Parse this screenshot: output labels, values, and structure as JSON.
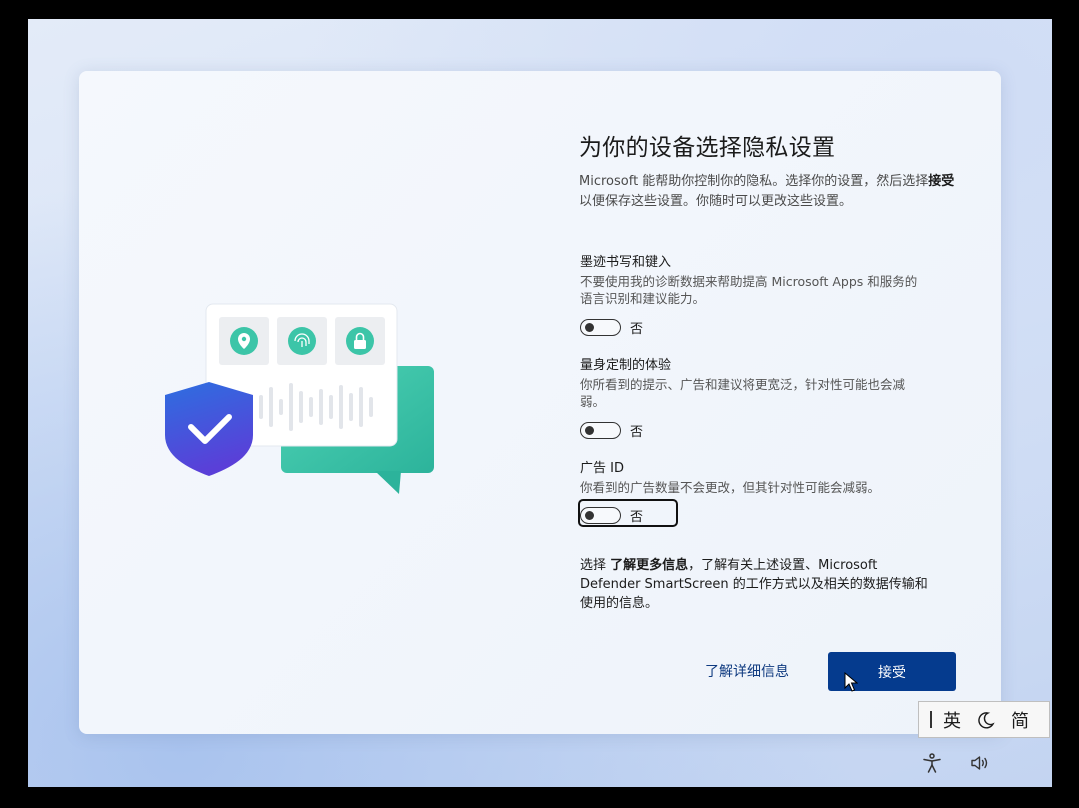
{
  "page": {
    "title": "为你的设备选择隐私设置",
    "intro_part1": "Microsoft 能帮助你控制你的隐私。选择你的设置，然后选择",
    "intro_bold": "接受",
    "intro_part2": "以便保存这些设置。你随时可以更改这些设置。"
  },
  "settings": [
    {
      "title": "墨迹书写和键入",
      "description": "不要使用我的诊断数据来帮助提高 Microsoft Apps 和服务的语言识别和建议能力。",
      "toggle_label": "否"
    },
    {
      "title": "量身定制的体验",
      "description": "你所看到的提示、广告和建议将更宽泛，针对性可能也会减弱。",
      "toggle_label": "否"
    },
    {
      "title": "广告 ID",
      "description": "你看到的广告数量不会更改，但其针对性可能会减弱。",
      "toggle_label": "否"
    }
  ],
  "more_info": {
    "prefix": "选择 ",
    "bold": "了解更多信息",
    "suffix": "，了解有关上述设置、Microsoft Defender SmartScreen 的工作方式以及相关的数据传输和使用的信息。"
  },
  "actions": {
    "learn_more_label": "了解详细信息",
    "accept_label": "接受"
  },
  "ime": {
    "mode": "英",
    "punct_icon": "moon-icon",
    "charset": "简"
  },
  "tray": {
    "icons": [
      "accessibility-icon",
      "speaker-icon"
    ]
  },
  "colors": {
    "accent": "#053b8e",
    "link": "#0f3a80",
    "shield": "#3a4fd6",
    "chat_bubble": "#3cc5a8"
  }
}
